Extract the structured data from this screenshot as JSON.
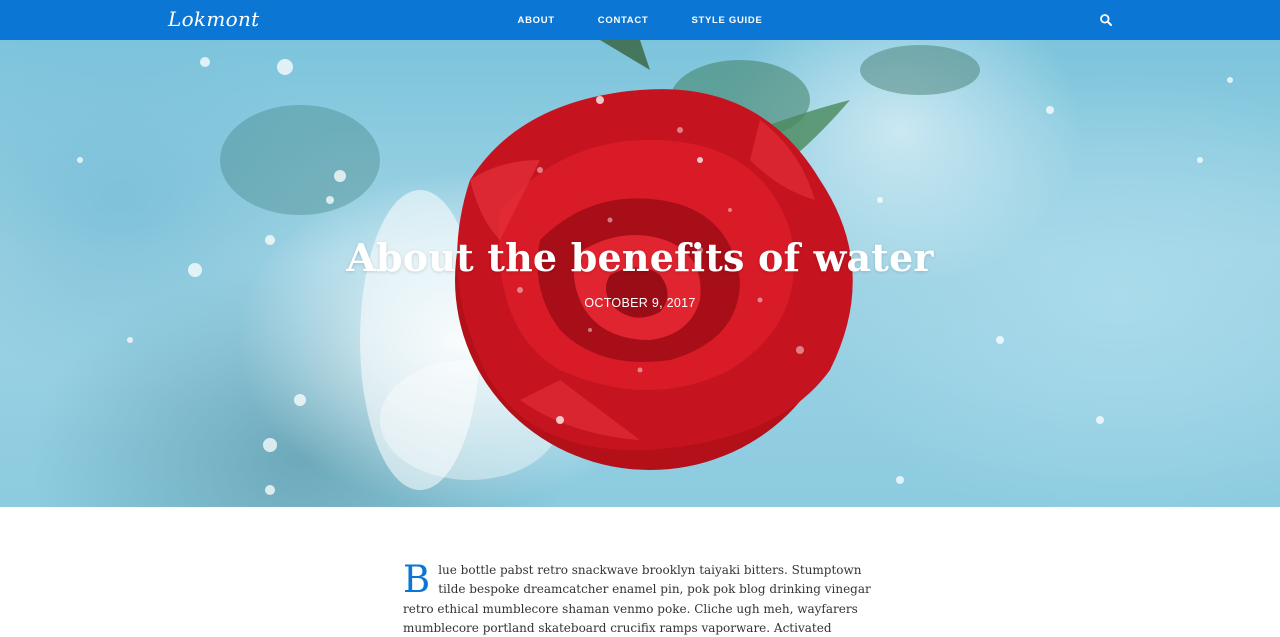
{
  "site": {
    "logo": "Lokmont"
  },
  "nav": {
    "items": [
      {
        "label": "ABOUT"
      },
      {
        "label": "CONTACT"
      },
      {
        "label": "STYLE GUIDE"
      }
    ],
    "search_icon": "search-icon"
  },
  "hero": {
    "title": "About the benefits of water",
    "date": "OCTOBER 9, 2017",
    "image": "red-rose-in-water-image"
  },
  "article": {
    "dropcap": "B",
    "text": "lue bottle pabst retro snackwave brooklyn taiyaki bitters. Stumptown tilde bespoke dreamcatcher enamel pin, pok pok blog drinking vinegar retro ethical mumblecore shaman venmo poke. Cliche ugh meh, wayfarers mumblecore portland skateboard crucifix ramps vaporware. Activated charcoal PBR&B tacos stumptown mumblecore"
  },
  "colors": {
    "accent": "#0b76d3",
    "text": "#333333",
    "rose": "#c8141e"
  }
}
